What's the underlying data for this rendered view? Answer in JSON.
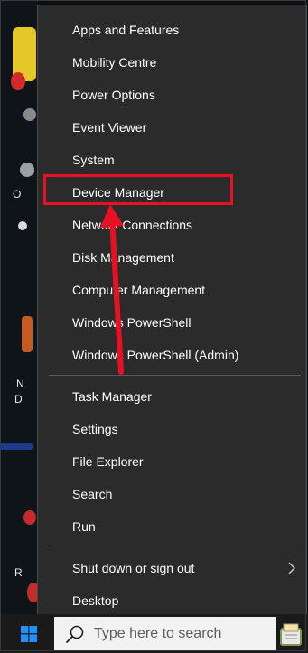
{
  "menu": {
    "items": [
      {
        "label": "Apps and Features"
      },
      {
        "label": "Mobility Centre"
      },
      {
        "label": "Power Options"
      },
      {
        "label": "Event Viewer"
      },
      {
        "label": "System"
      },
      {
        "label": "Device Manager"
      },
      {
        "label": "Network Connections"
      },
      {
        "label": "Disk Management"
      },
      {
        "label": "Computer Management"
      },
      {
        "label": "Windows PowerShell"
      },
      {
        "label": "Windows PowerShell (Admin)"
      },
      {
        "label": "Task Manager"
      },
      {
        "label": "Settings"
      },
      {
        "label": "File Explorer"
      },
      {
        "label": "Search"
      },
      {
        "label": "Run"
      },
      {
        "label": "Shut down or sign out"
      },
      {
        "label": "Desktop"
      }
    ],
    "highlighted_item": "Device Manager",
    "submenu_icon": "chevron-right-icon"
  },
  "desktop": {
    "letters": [
      "O",
      "N",
      "D",
      "R"
    ]
  },
  "taskbar": {
    "start_icon": "windows-logo-icon",
    "search_icon": "search-icon",
    "search_placeholder": "Type here to search",
    "tray_icon": "notepad-icon"
  },
  "colors": {
    "menu_bg": "#2b2b2b",
    "highlight": "#e81123",
    "windows_blue": "#1e90ff",
    "taskbar_bg": "#1a1a1a"
  }
}
